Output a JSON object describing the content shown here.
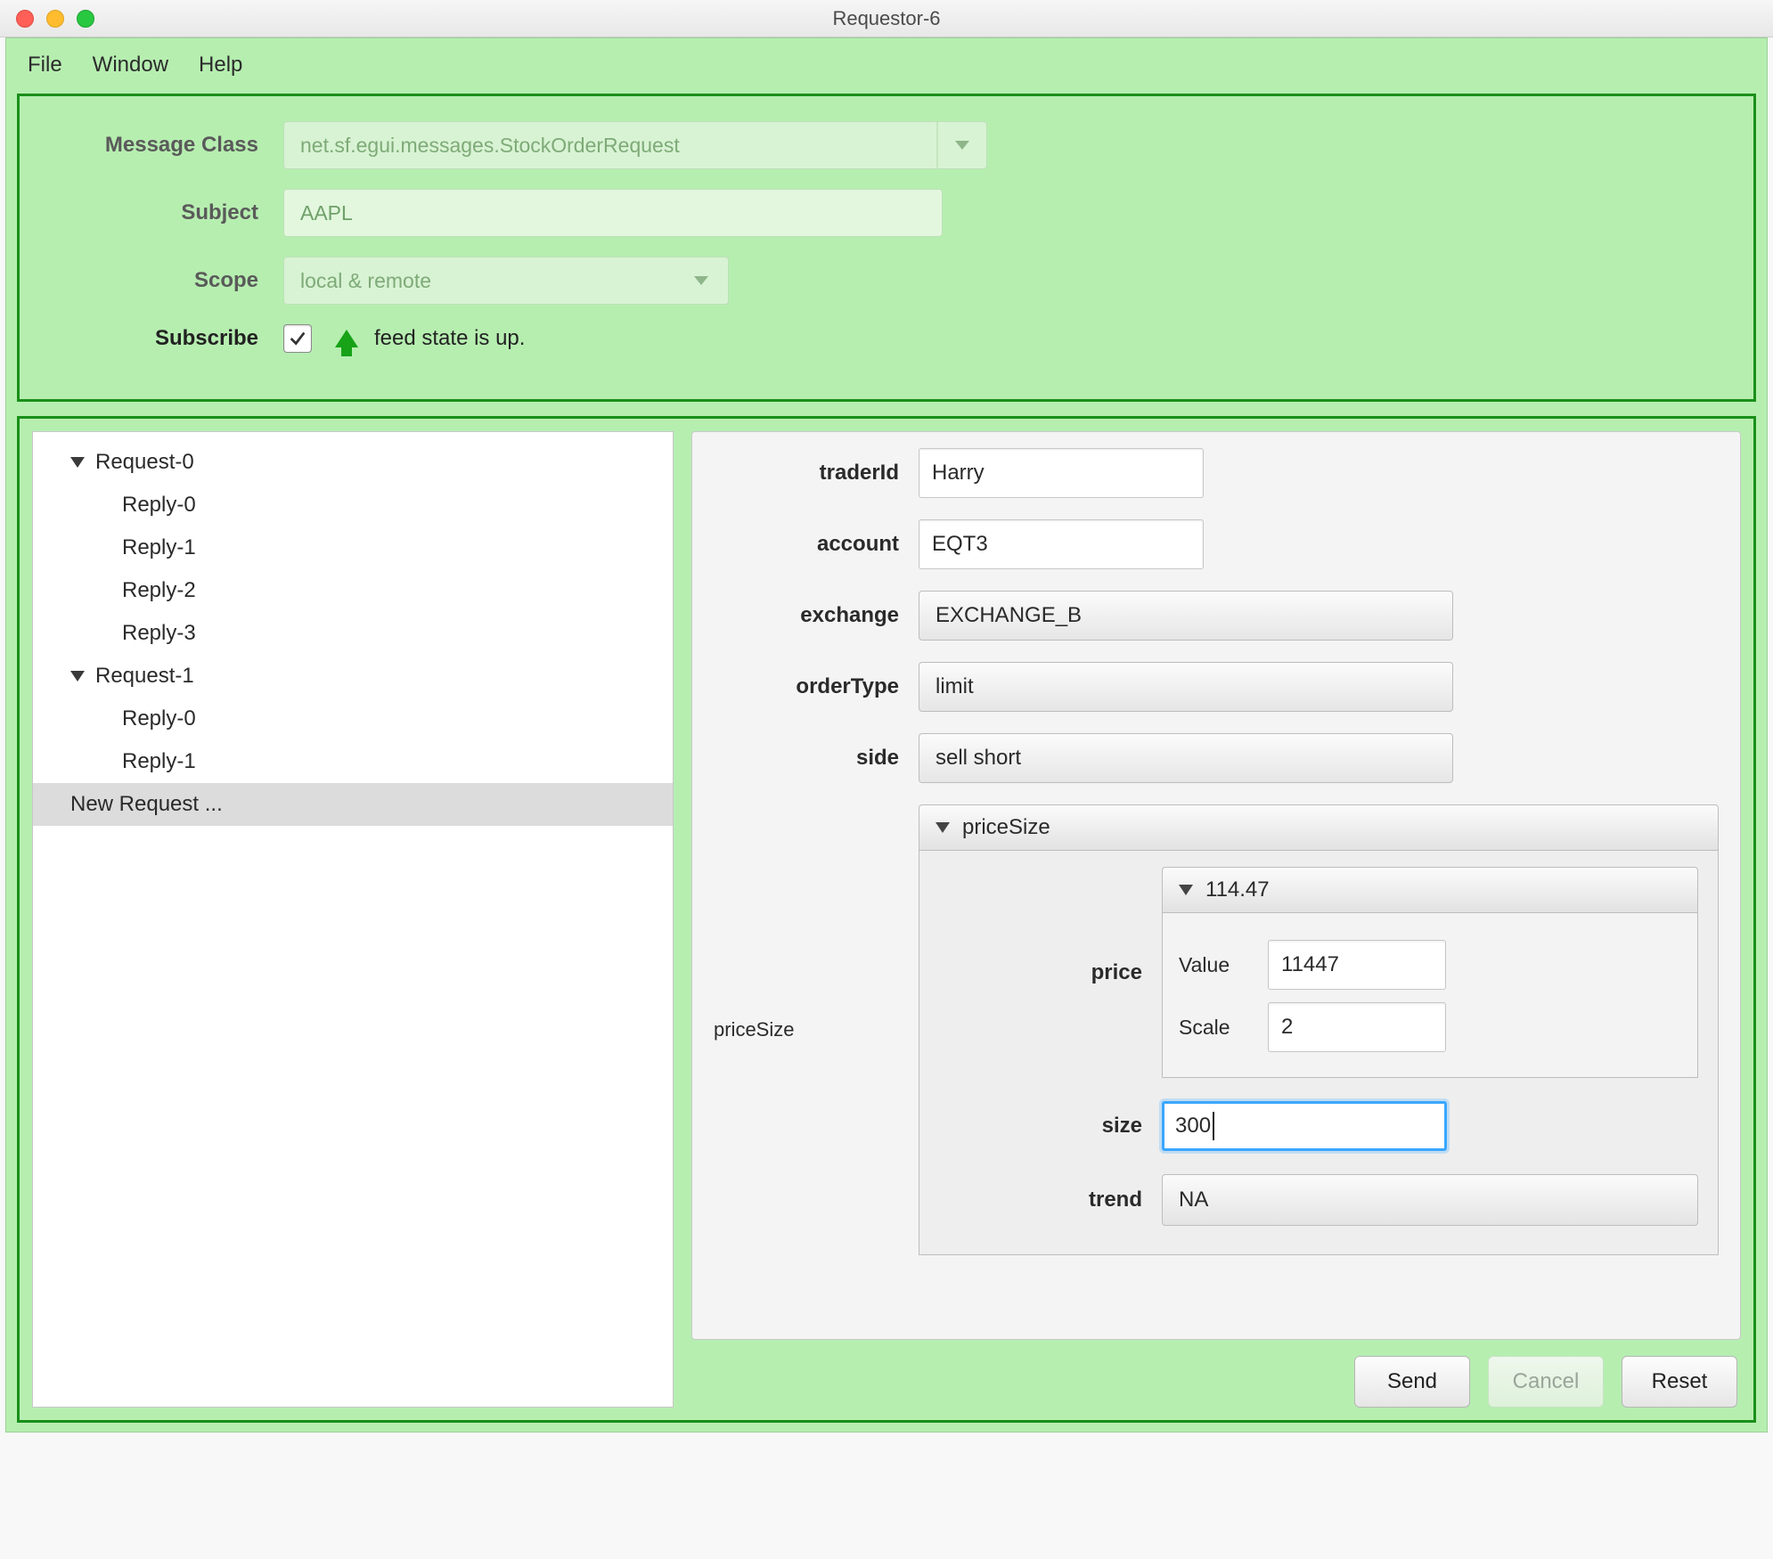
{
  "window": {
    "title": "Requestor-6"
  },
  "menubar": [
    "File",
    "Window",
    "Help"
  ],
  "top": {
    "messageClass": {
      "label": "Message Class",
      "value": "net.sf.egui.messages.StockOrderRequest"
    },
    "subject": {
      "label": "Subject",
      "value": "AAPL"
    },
    "scope": {
      "label": "Scope",
      "value": "local & remote"
    },
    "subscribe": {
      "label": "Subscribe",
      "checked": true
    },
    "feed": {
      "text": "feed state is up."
    }
  },
  "tree": {
    "items": [
      {
        "label": "Request-0",
        "type": "parent"
      },
      {
        "label": "Reply-0",
        "type": "child"
      },
      {
        "label": "Reply-1",
        "type": "child"
      },
      {
        "label": "Reply-2",
        "type": "child"
      },
      {
        "label": "Reply-3",
        "type": "child"
      },
      {
        "label": "Request-1",
        "type": "parent"
      },
      {
        "label": "Reply-0",
        "type": "child"
      },
      {
        "label": "Reply-1",
        "type": "child"
      },
      {
        "label": "New Request ...",
        "type": "selected"
      }
    ]
  },
  "form": {
    "traderId": {
      "label": "traderId",
      "value": "Harry"
    },
    "account": {
      "label": "account",
      "value": "EQT3"
    },
    "exchange": {
      "label": "exchange",
      "value": "EXCHANGE_B"
    },
    "orderType": {
      "label": "orderType",
      "value": "limit"
    },
    "side": {
      "label": "side",
      "value": "sell short"
    },
    "priceSize": {
      "label": "priceSize",
      "header": "priceSize",
      "price": {
        "label": "price",
        "header": "114.47",
        "value": {
          "label": "Value",
          "value": "11447"
        },
        "scale": {
          "label": "Scale",
          "value": "2"
        }
      },
      "size": {
        "label": "size",
        "value": "300"
      },
      "trend": {
        "label": "trend",
        "value": "NA"
      }
    }
  },
  "buttons": {
    "send": "Send",
    "cancel": "Cancel",
    "reset": "Reset"
  }
}
